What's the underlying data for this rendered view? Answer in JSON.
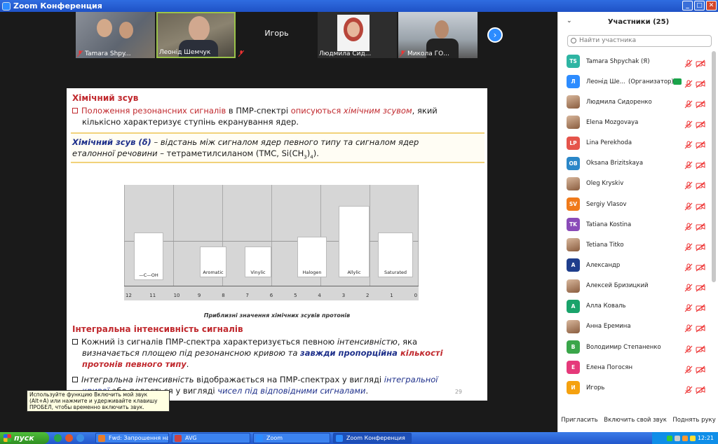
{
  "window": {
    "title": "Zoom Конференция"
  },
  "thumbnails": [
    {
      "name": "Tamara Shpy...",
      "muted": true
    },
    {
      "name": "Леонід Шемчук",
      "muted": false
    },
    {
      "name": "Игорь",
      "muted": true
    },
    {
      "name": "Людмила Сид...",
      "muted": false
    },
    {
      "name": "Микола ГО...",
      "muted": true
    }
  ],
  "slide": {
    "h1": "Хімічний зсув",
    "p1_a": "Положення резонансних сигналів",
    "p1_b": " в ПМР-спектрі ",
    "p1_c": "описуються",
    "p1_d": " хімічним зсувом",
    "p1_e": ", який",
    "p1_line2": "кількісно характеризує ступінь екранування ядер.",
    "def_a": "Хімічний зсув (δ)",
    "def_b": " – відстань між сигналом ядер певного типу та сигналом ядер",
    "def_line2a": "еталонної речовини",
    "def_line2b": " – тетраметилсиланом (ТМС, Si(CH",
    "def_line2c": ")",
    "def_line2d": ").",
    "sub3": "3",
    "sub4": "4",
    "chart_caption": "Приблизні значення хімічних зсувів протонів",
    "h2": "Інтегральна інтенсивність сигналів",
    "b1_a": "Кожний із сигналів ПМР-спектра характеризується певною ",
    "b1_b": "інтенсивністю",
    "b1_c": ", яка",
    "b1_line2a": "визначається площею під резонансною кривою та ",
    "b1_line2b": "завжди пропорційна ",
    "b1_line2c": "кількості",
    "b1_line3": "протонів певного типу",
    "b1_line3end": ".",
    "b2_a": "Інтегральна інтенсивність",
    "b2_b": " відображається на ПМР-спектрах у вигляді ",
    "b2_c": "інтегральної",
    "b2_line2a": "кривої",
    "b2_line2b": " або подається у вигляді ",
    "b2_line2c": "чисел під відповідними сигналами",
    "b2_line2d": ".",
    "page_number": "29"
  },
  "chart_structures": [
    {
      "top": "O\n‖\n—C—H",
      "bottom": "O\n‖\n—C—OH"
    },
    {
      "label": "Aromatic"
    },
    {
      "label": "Vinylic"
    },
    {
      "label": "Halogen",
      "sub": "Y = O, N,"
    },
    {
      "label": "Allylic"
    },
    {
      "label": "Saturated"
    }
  ],
  "chart_axis": [
    "12",
    "11",
    "10",
    "9",
    "8",
    "7",
    "6",
    "5",
    "4",
    "3",
    "2",
    "1",
    "0"
  ],
  "tooltip": "Используйте функцию Включить мой звук (Alt+A) или нажмите и удерживайте клавишу ПРОБЕЛ, чтобы временно включить звук.",
  "participants_panel": {
    "header": "Участники (25)",
    "search_placeholder": "Найти участника",
    "participants": [
      {
        "initials": "TS",
        "name": "Tamara Shpychak (Я)",
        "color": "#2eb5a3",
        "photo": false,
        "role": ""
      },
      {
        "initials": "Л",
        "name": "Леонід Ше...",
        "color": "#2d8cff",
        "photo": false,
        "role": "(Организатор)"
      },
      {
        "initials": "",
        "name": "Людмила Сидоренко",
        "color": "",
        "photo": true,
        "role": ""
      },
      {
        "initials": "",
        "name": "Elena Mozgovaya",
        "color": "",
        "photo": true,
        "role": ""
      },
      {
        "initials": "LP",
        "name": "Lina Perekhoda",
        "color": "#e5544b",
        "photo": false,
        "role": ""
      },
      {
        "initials": "OB",
        "name": "Oksana Brizitskaya",
        "color": "#2b87c8",
        "photo": false,
        "role": ""
      },
      {
        "initials": "",
        "name": "Oleg Kryskiv",
        "color": "",
        "photo": true,
        "role": ""
      },
      {
        "initials": "SV",
        "name": "Sergiy Vlasov",
        "color": "#f07a1a",
        "photo": false,
        "role": ""
      },
      {
        "initials": "TK",
        "name": "Tatiana Kostina",
        "color": "#8a4bb8",
        "photo": false,
        "role": ""
      },
      {
        "initials": "",
        "name": "Tetiana Titko",
        "color": "",
        "photo": true,
        "role": ""
      },
      {
        "initials": "А",
        "name": "Александр",
        "color": "#1f3e8c",
        "photo": false,
        "role": ""
      },
      {
        "initials": "",
        "name": "Алексей Бризицкий",
        "color": "",
        "photo": true,
        "role": ""
      },
      {
        "initials": "А",
        "name": "Алла Коваль",
        "color": "#1aa36b",
        "photo": false,
        "role": ""
      },
      {
        "initials": "",
        "name": "Анна Еремина",
        "color": "",
        "photo": true,
        "role": ""
      },
      {
        "initials": "В",
        "name": "Володимир Степаненко",
        "color": "#3aa64a",
        "photo": false,
        "role": ""
      },
      {
        "initials": "Е",
        "name": "Елена Погосян",
        "color": "#e5397a",
        "photo": false,
        "role": ""
      },
      {
        "initials": "И",
        "name": "Игорь",
        "color": "#f5a10f",
        "photo": false,
        "role": ""
      }
    ],
    "footer": {
      "invite": "Пригласить",
      "unmute": "Включить свой звук",
      "raise_hand": "Поднять руку"
    }
  },
  "taskbar": {
    "start": "пуск",
    "tasks": [
      {
        "label": "Fwd: Запрошення на...",
        "color": "#e87d2a",
        "active": false
      },
      {
        "label": "AVG",
        "color": "#c44",
        "active": false
      },
      {
        "label": "Zoom",
        "color": "#2d8cff",
        "active": false
      },
      {
        "label": "Zoom Конференция",
        "color": "#2d8cff",
        "active": true
      }
    ],
    "clock": "12:21"
  }
}
